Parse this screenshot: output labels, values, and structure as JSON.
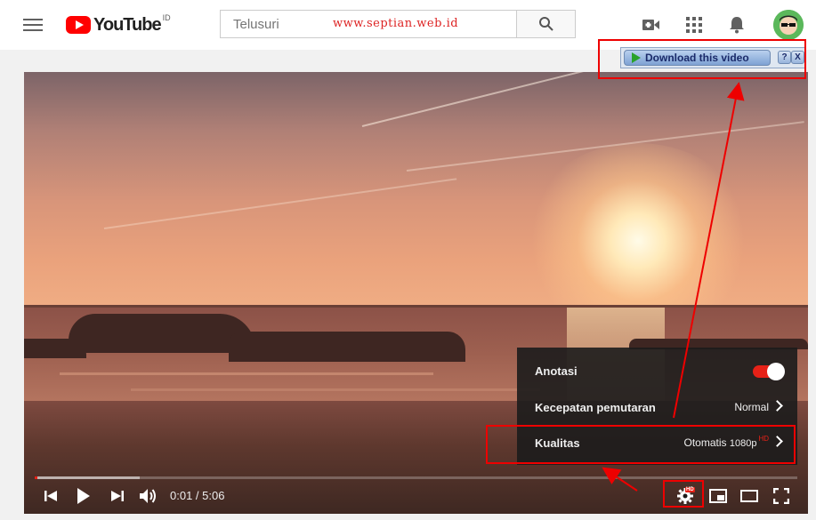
{
  "header": {
    "logo_text": "YouTube",
    "logo_country": "ID",
    "search_placeholder": "Telusuri",
    "watermark": "www.septian.web.id",
    "icons": [
      "menu-icon",
      "search-icon",
      "upload-video-icon",
      "apps-grid-icon",
      "notifications-bell-icon",
      "avatar"
    ]
  },
  "download_bar": {
    "button_label": "Download this video",
    "help_label": "?",
    "close_label": "X"
  },
  "settings_menu": {
    "items": [
      {
        "label": "Anotasi",
        "toggle_on": true
      },
      {
        "label": "Kecepatan pemutaran",
        "value": "Normal"
      },
      {
        "label": "Kualitas",
        "value": "Otomatis",
        "sub_value": "1080p",
        "badge": "HD"
      }
    ]
  },
  "player": {
    "current_time": "0:01",
    "duration": "5:06",
    "time_display": "0:01 / 5:06",
    "progress_played": 0.002,
    "progress_loaded": 0.138,
    "settings_badge": "HD"
  },
  "colors": {
    "youtube_red": "#ff0000",
    "accent_red": "#e62117",
    "annotation_red": "#e00000"
  }
}
